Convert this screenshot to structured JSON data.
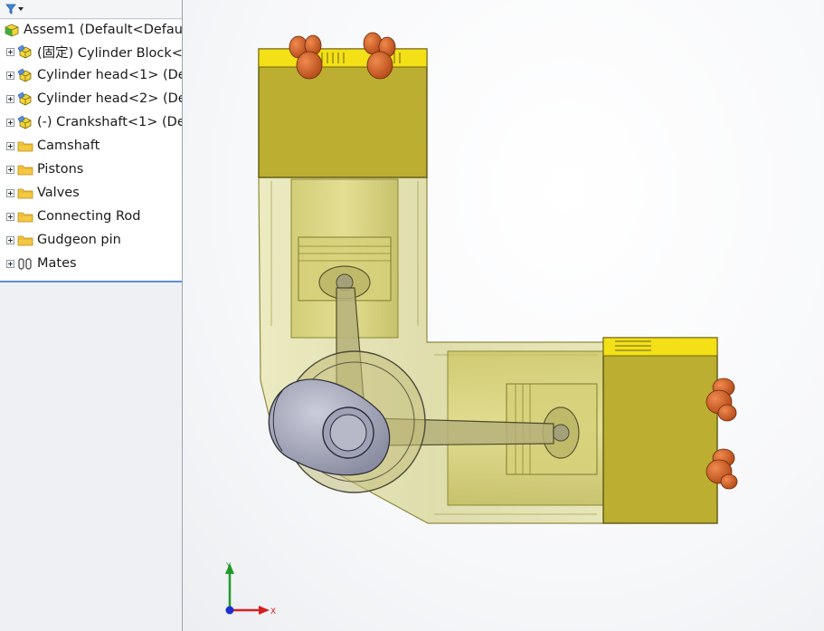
{
  "tree": {
    "root": {
      "label": "Assem1  (Default<Defau",
      "icon": "assembly-icon"
    },
    "items": [
      {
        "label": "(固定) Cylinder Block<",
        "icon": "part-icon"
      },
      {
        "label": "Cylinder head<1> (De",
        "icon": "part-icon"
      },
      {
        "label": "Cylinder head<2> (De",
        "icon": "part-icon"
      },
      {
        "label": "(-) Crankshaft<1> (De",
        "icon": "part-icon"
      },
      {
        "label": "Camshaft",
        "icon": "folder-icon"
      },
      {
        "label": "Pistons",
        "icon": "folder-icon"
      },
      {
        "label": "Valves",
        "icon": "folder-icon"
      },
      {
        "label": "Connecting Rod",
        "icon": "folder-icon"
      },
      {
        "label": "Gudgeon pin",
        "icon": "folder-icon"
      },
      {
        "label": "Mates",
        "icon": "mates-icon"
      }
    ]
  },
  "triad": {
    "x_label": "X",
    "y_label": "Y"
  },
  "colors": {
    "block_fill": "#d8d79a",
    "head_fill": "#b8a82c",
    "head_top": "#f2dd15",
    "valve": "#d2622a",
    "crank": "#9c9fb2",
    "folder": "#f5c842",
    "x_axis": "#d42020",
    "y_axis": "#1f9a2a",
    "z_axis": "#1d2ed0"
  }
}
